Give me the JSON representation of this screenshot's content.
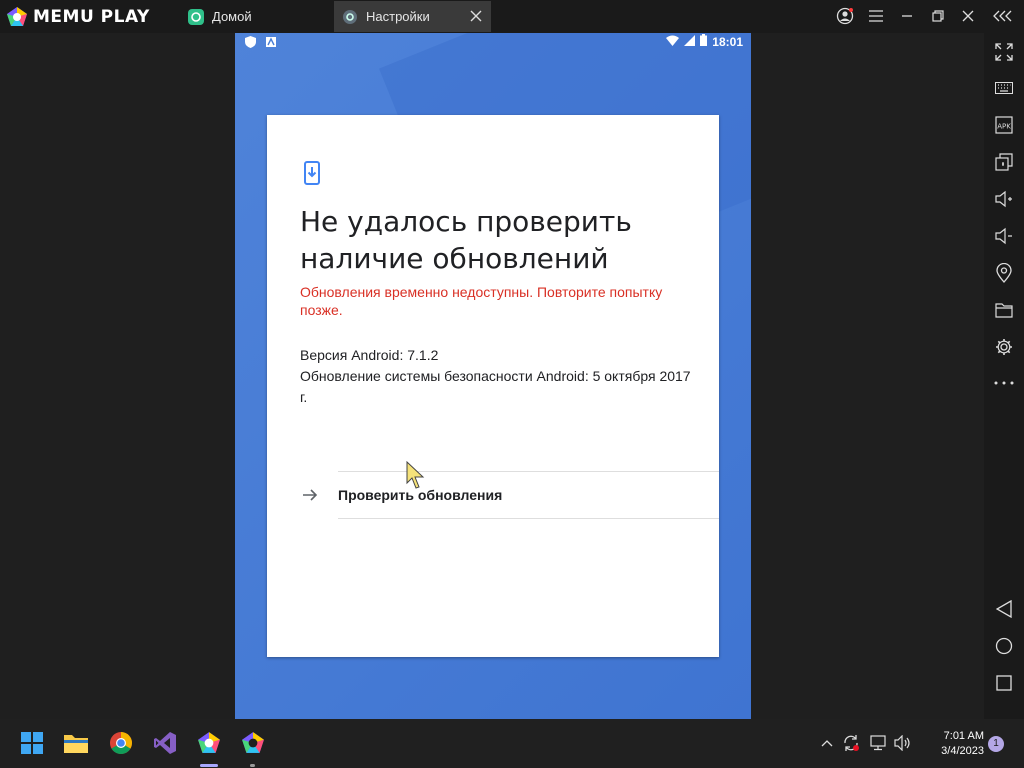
{
  "app": {
    "logo_text": "MEMU PLAY"
  },
  "tabs": [
    {
      "label": "Домой",
      "active": false
    },
    {
      "label": "Настройки",
      "active": true
    }
  ],
  "android_status": {
    "time": "18:01"
  },
  "update_card": {
    "heading": "Не удалось проверить наличие обновлений",
    "error": "Обновления временно недоступны. Повторите попытку позже.",
    "android_version": "Версия Android: 7.1.2",
    "security_update": "Обновление системы безопасности Android: 5 октября 2017 г.",
    "check_button": "Проверить обновления"
  },
  "taskbar": {
    "time": "7:01 AM",
    "date": "3/4/2023",
    "notifications": "1"
  },
  "colors": {
    "accent_blue": "#4a7fd6",
    "error_red": "#d93025",
    "frame_bg": "#1f1f1f"
  }
}
